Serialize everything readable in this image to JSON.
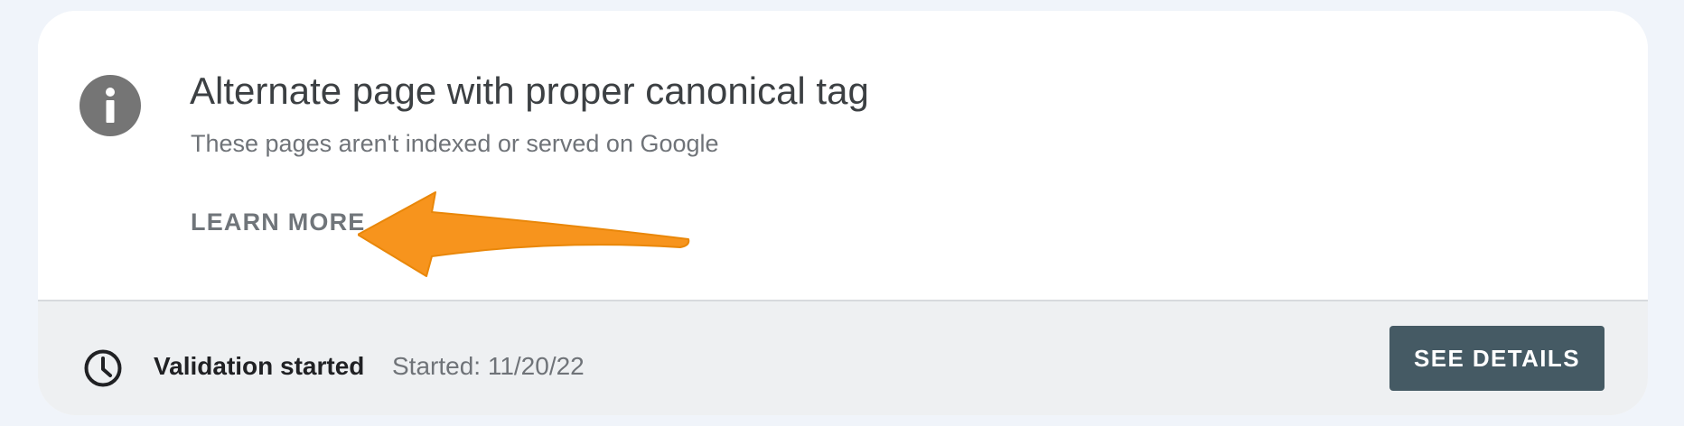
{
  "issue": {
    "icon": "info-icon",
    "title": "Alternate page with proper canonical tag",
    "subtitle": "These pages aren't indexed or served on Google",
    "learn_more_label": "LEARN MORE"
  },
  "annotation": {
    "icon": "arrow-left-annotation",
    "color": "#f7941d"
  },
  "validation": {
    "icon": "clock-icon",
    "status": "Validation started",
    "date_text": "Started: 11/20/22",
    "button_label": "SEE DETAILS"
  },
  "colors": {
    "page_background": "#f0f4fa",
    "card_background": "#ffffff",
    "footer_background": "#eef0f2",
    "button_background": "#455a64",
    "icon_grey": "#757575"
  }
}
